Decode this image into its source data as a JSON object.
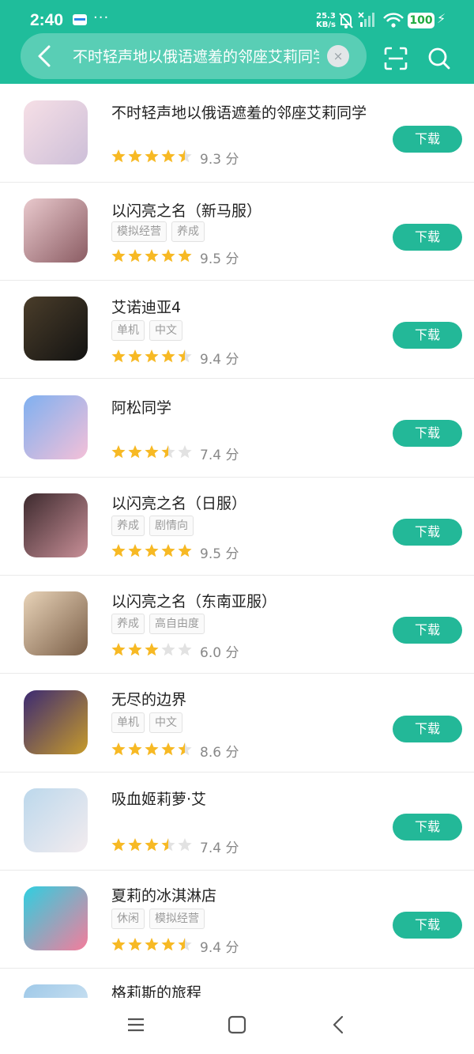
{
  "status_bar": {
    "time": "2:40",
    "dots": "···",
    "net_speed_value": "25.3",
    "net_speed_unit": "KB/s",
    "battery": "100"
  },
  "search": {
    "query": "不时轻声地以俄语遮羞的邻座艾莉同学",
    "clear_glyph": "×"
  },
  "download_label": "下载",
  "items": [
    {
      "title": "不时轻声地以俄语遮羞的邻座艾莉同学",
      "tags": [],
      "rating": "9.3 分",
      "stars": 4.5,
      "colors": [
        "#f6dfe6",
        "#cdbfd8"
      ]
    },
    {
      "title": "以闪亮之名（新马服）",
      "tags": [
        "模拟经营",
        "养成"
      ],
      "rating": "9.5 分",
      "stars": 5,
      "colors": [
        "#e9c9cd",
        "#8b5c63"
      ]
    },
    {
      "title": "艾诺迪亚4",
      "tags": [
        "单机",
        "中文"
      ],
      "rating": "9.4 分",
      "stars": 4.5,
      "colors": [
        "#4a3d2a",
        "#131312"
      ]
    },
    {
      "title": "阿松同学",
      "tags": [],
      "rating": "7.4 分",
      "stars": 3.5,
      "colors": [
        "#7fb0f0",
        "#f4c0d8"
      ]
    },
    {
      "title": "以闪亮之名（日服）",
      "tags": [
        "养成",
        "剧情向"
      ],
      "rating": "9.5 分",
      "stars": 5,
      "colors": [
        "#3d2a2e",
        "#c88f97"
      ]
    },
    {
      "title": "以闪亮之名（东南亚服）",
      "tags": [
        "养成",
        "高自由度"
      ],
      "rating": "6.0 分",
      "stars": 3,
      "colors": [
        "#e8d3b8",
        "#7b5f48"
      ]
    },
    {
      "title": "无尽的边界",
      "tags": [
        "单机",
        "中文"
      ],
      "rating": "8.6 分",
      "stars": 4.5,
      "colors": [
        "#3c2a72",
        "#c79b2b"
      ]
    },
    {
      "title": "吸血姬莉萝·艾",
      "tags": [],
      "rating": "7.4 分",
      "stars": 3.5,
      "colors": [
        "#bcd8ec",
        "#f3ecef"
      ]
    },
    {
      "title": "夏莉的冰淇淋店",
      "tags": [
        "休闲",
        "模拟经营"
      ],
      "rating": "9.4 分",
      "stars": 4.5,
      "colors": [
        "#2fcfe0",
        "#f57c9b"
      ]
    },
    {
      "title": "格莉斯的旅程",
      "tags": [],
      "rating": "",
      "stars": 0,
      "colors": [
        "#9fc9e8",
        "#dbeaf5"
      ]
    }
  ],
  "colors": {
    "accent": "#1fbd9b",
    "button": "#23b898",
    "star_on": "#f7b924",
    "star_off": "#e2e2e2"
  }
}
